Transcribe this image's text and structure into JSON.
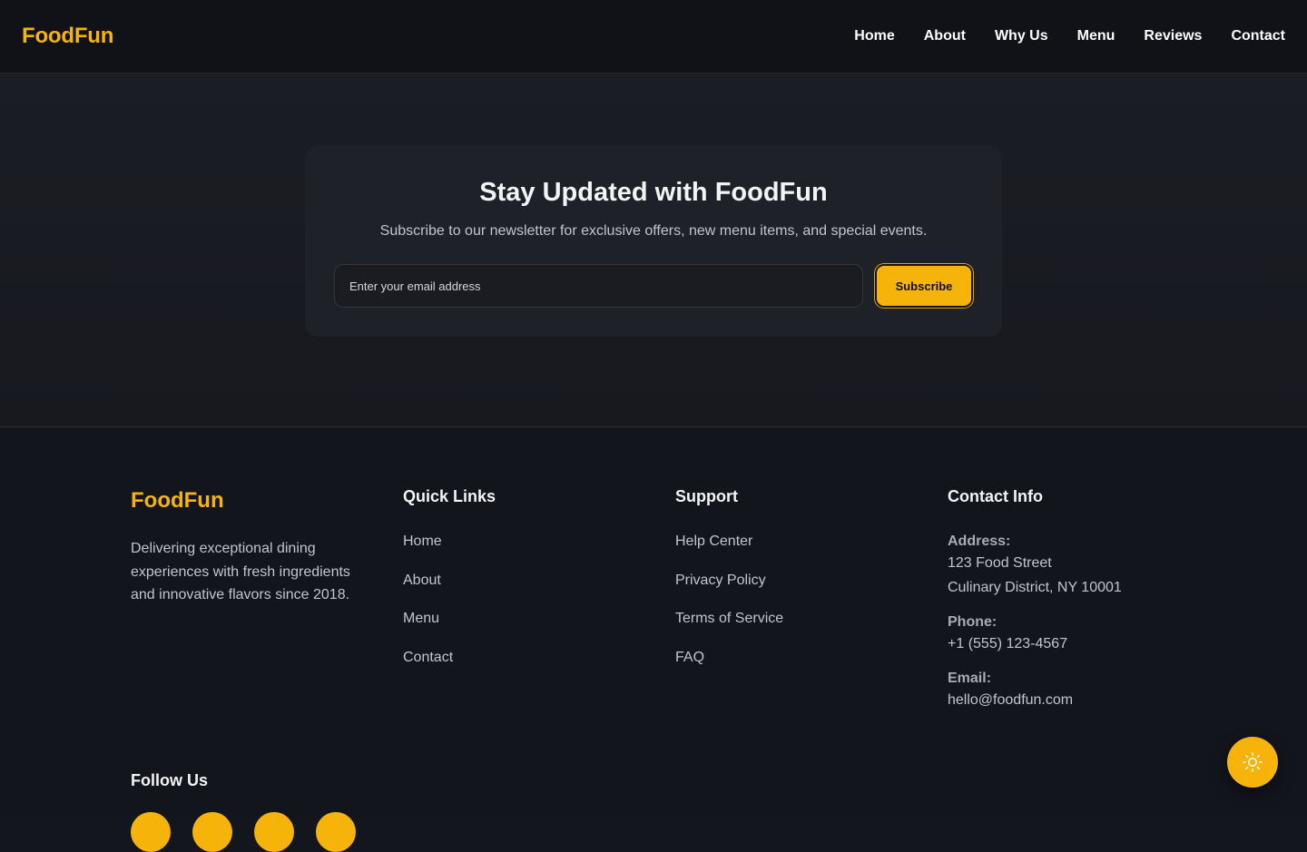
{
  "header": {
    "brand": "FoodFun",
    "nav": [
      "Home",
      "About",
      "Why Us",
      "Menu",
      "Reviews",
      "Contact"
    ]
  },
  "newsletter": {
    "title": "Stay Updated with FoodFun",
    "subtitle": "Subscribe to our newsletter for exclusive offers, new menu items, and special events.",
    "email_placeholder": "Enter your email address",
    "subscribe_label": "Subscribe"
  },
  "footer": {
    "brand": "FoodFun",
    "description": "Delivering exceptional dining experiences with fresh ingredients and innovative flavors since 2018.",
    "quick_links": {
      "title": "Quick Links",
      "items": [
        "Home",
        "About",
        "Menu",
        "Contact"
      ]
    },
    "support": {
      "title": "Support",
      "items": [
        "Help Center",
        "Privacy Policy",
        "Terms of Service",
        "FAQ"
      ]
    },
    "contact": {
      "title": "Contact Info",
      "address_label": "Address:",
      "address_line1": "123 Food Street",
      "address_line2": "Culinary District, NY 10001",
      "phone_label": "Phone:",
      "phone": "+1 (555) 123-4567",
      "email_label": "Email:",
      "email": "hello@foodfun.com"
    },
    "follow_title": "Follow Us",
    "social_icons": [
      "social-icon-1",
      "social-icon-2",
      "social-icon-3",
      "social-icon-4"
    ]
  },
  "theme_toggle_icon": "sun-icon",
  "colors": {
    "accent": "#f6b40a",
    "background": "#14161d",
    "card": "#1f2128"
  }
}
